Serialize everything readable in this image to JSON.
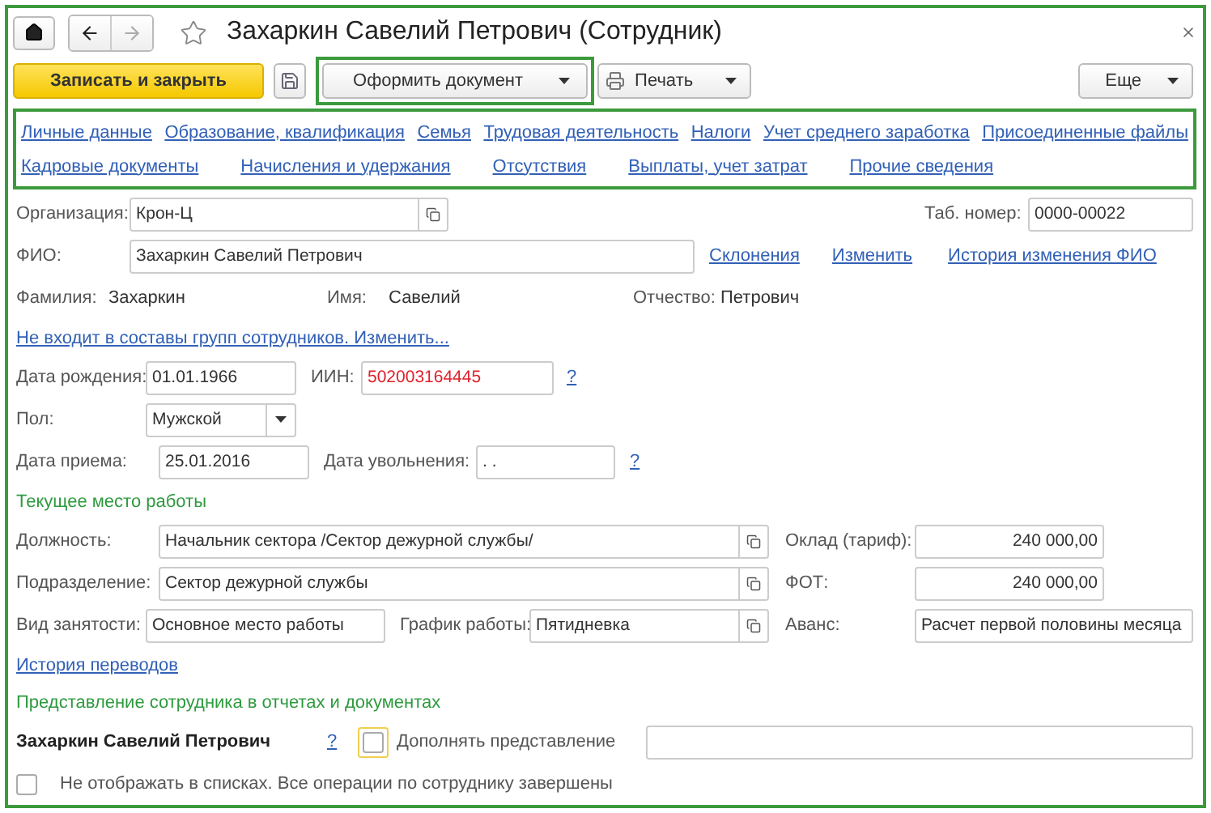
{
  "window": {
    "title": "Захаркин Савелий Петрович (Сотрудник)"
  },
  "toolbar": [
    {
      "kind": "primary",
      "label": "Записать и закрыть"
    },
    {
      "kind": "icon"
    },
    {
      "kind": "menu",
      "label": "Оформить документ",
      "highlighted": true
    },
    {
      "kind": "print",
      "label": "Печать",
      "highlighted": false
    },
    {
      "kind": "more",
      "label": "Еще",
      "highlighted": false
    }
  ],
  "link_rows": [
    [
      "Личные данные",
      "Образование, квалификация",
      "Семья",
      "Трудовая деятельность",
      "Налоги",
      "Учет среднего заработка",
      "Присоединенные файлы"
    ],
    [
      "Кадровые документы",
      "Начисления и удержания",
      "Отсутствия",
      "Выплаты, учет затрат",
      "Прочие сведения"
    ]
  ],
  "rows": [
    {
      "items": [
        {
          "kind": "label",
          "text": "Организация:"
        },
        {
          "kind": "lookup",
          "value": "Крон-Ц"
        },
        {
          "kind": "label",
          "text": "Таб. номер:"
        },
        {
          "kind": "input",
          "value": "0000-00022"
        }
      ]
    },
    {
      "items": [
        {
          "kind": "label",
          "text": "ФИО:"
        },
        {
          "kind": "input",
          "value": "Захаркин Савелий Петрович"
        },
        {
          "kind": "link",
          "text": "Склонения"
        },
        {
          "kind": "link",
          "text": "Изменить"
        },
        {
          "kind": "link",
          "text": "История изменения ФИО"
        }
      ]
    },
    {
      "items": [
        {
          "kind": "label",
          "text": "Фамилия:"
        },
        {
          "kind": "text",
          "text": "Захаркин"
        },
        {
          "kind": "label",
          "text": "Имя:"
        },
        {
          "kind": "text",
          "text": "Савелий"
        },
        {
          "kind": "label",
          "text": "Отчество:"
        },
        {
          "kind": "text",
          "text": "Петрович"
        }
      ]
    },
    {
      "items": [
        {
          "kind": "link",
          "text": "Не входит в составы групп сотрудников. Изменить..."
        }
      ]
    },
    {
      "items": [
        {
          "kind": "label",
          "text": "Дата рождения:"
        },
        {
          "kind": "input",
          "value": "01.01.1966"
        },
        {
          "kind": "label",
          "text": "ИИН:"
        },
        {
          "kind": "input",
          "value": "502003164445",
          "error": true
        },
        {
          "kind": "help",
          "text": "?"
        }
      ]
    },
    {
      "items": [
        {
          "kind": "label",
          "text": "Пол:"
        },
        {
          "kind": "select",
          "value": "Мужской"
        }
      ]
    },
    {
      "items": [
        {
          "kind": "label",
          "text": "Дата приема:"
        },
        {
          "kind": "input",
          "value": "25.01.2016"
        },
        {
          "kind": "label",
          "text": "Дата увольнения:"
        },
        {
          "kind": "input",
          "value": ".  ."
        },
        {
          "kind": "help",
          "text": "?"
        }
      ]
    },
    {
      "items": [
        {
          "kind": "section",
          "text": "Текущее место работы"
        }
      ]
    },
    {
      "items": [
        {
          "kind": "label",
          "text": "Должность:"
        },
        {
          "kind": "lookup",
          "value": "Начальник сектора /Сектор дежурной службы/"
        },
        {
          "kind": "label",
          "text": "Оклад (тариф):"
        },
        {
          "kind": "number",
          "value": "240 000,00"
        }
      ]
    },
    {
      "items": [
        {
          "kind": "label",
          "text": "Подразделение:"
        },
        {
          "kind": "lookup",
          "value": "Сектор дежурной службы"
        },
        {
          "kind": "label",
          "text": "ФОТ:"
        },
        {
          "kind": "number",
          "value": "240 000,00"
        }
      ]
    },
    {
      "items": [
        {
          "kind": "label",
          "text": "Вид занятости:"
        },
        {
          "kind": "input",
          "value": "Основное место работы"
        },
        {
          "kind": "label",
          "text": "График работы:"
        },
        {
          "kind": "lookup",
          "value": "Пятидневка"
        },
        {
          "kind": "label",
          "text": "Аванс:"
        },
        {
          "kind": "input",
          "value": "Расчет первой половины месяца"
        }
      ]
    },
    {
      "items": [
        {
          "kind": "link",
          "text": "История переводов"
        }
      ]
    },
    {
      "items": [
        {
          "kind": "section",
          "text": "Представление сотрудника в отчетах и документах"
        }
      ]
    },
    {
      "items": [
        {
          "kind": "bold",
          "text": "Захаркин Савелий Петрович"
        },
        {
          "kind": "help",
          "text": "?"
        },
        {
          "kind": "checkbox",
          "checked": false,
          "focused": true
        },
        {
          "kind": "label",
          "text": "Дополнять представление"
        },
        {
          "kind": "input",
          "value": ""
        }
      ]
    },
    {
      "items": [
        {
          "kind": "checkbox",
          "checked": false,
          "focused": false
        },
        {
          "kind": "label",
          "text": "Не отображать в списках. Все операции по сотруднику завершены"
        }
      ]
    }
  ]
}
